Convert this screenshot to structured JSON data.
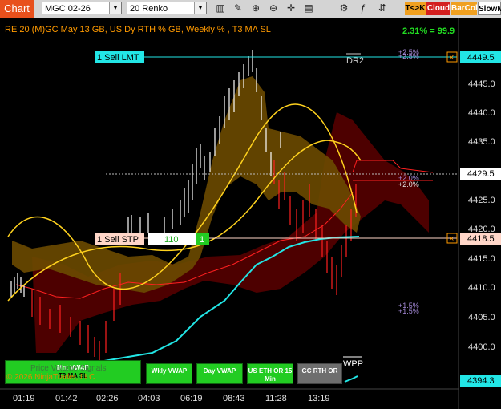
{
  "toolbar": {
    "chart_tab": "Chart",
    "instrument": "MGC 02-26",
    "bar_type": "20 Renko",
    "tk_label": "T<>K",
    "cloud_label": "Cloud",
    "barcol_label": "BarCol",
    "slowm_label": "SlowM",
    "icons": [
      "bar-style-icon",
      "drawing-tool-icon",
      "zoom-in-icon",
      "zoom-out-icon",
      "crosshair-icon",
      "properties-icon",
      "strategy-icon",
      "indicator-icon",
      "chart-trader-icon"
    ]
  },
  "chart": {
    "header": "RE 20  (M)GC May 13 GB, US Dy RTH % GB, Weekly % , T3 MA SL",
    "pct_readout": "2.31% = 99.9",
    "copyright": "© 2026 NinjaTrader, LLC",
    "watermark": "Price Volume Signals",
    "dr2_label": "DR2",
    "wpp_label": "WPP",
    "pct_plus25": "+2.5%",
    "pct_plus20": "+2.0%",
    "pct_plus15": "+1.5%",
    "sell_lmt": "1 Sell LMT",
    "sell_stp": "1 Sell STP",
    "stp_qty": "110",
    "stp_count": "1",
    "price_axis": [
      "4445.0",
      "4440.0",
      "4435.0",
      "4425.0",
      "4420.0",
      "4415.0",
      "4410.0",
      "4405.0",
      "4400.0"
    ],
    "price_tag_lmt": "4449.5",
    "price_tag_last": "4429.5",
    "price_tag_stp": "4418.5",
    "price_tag_bottom": "4394.3",
    "time_axis": [
      "01:19",
      "01:42",
      "02:26",
      "04:03",
      "06:19",
      "08:43",
      "11:28",
      "13:19"
    ],
    "close_icon": "×",
    "buttons": [
      {
        "label": "Mnt VWAP",
        "sub": "T3 MA SL"
      },
      {
        "label": "Wkly VWAP",
        "sub": ""
      },
      {
        "label": "Day VWAP",
        "sub": ""
      },
      {
        "label": "US ETH OR 15 Min",
        "sub": ""
      },
      {
        "label": "GC RTH OR",
        "sub": ""
      }
    ]
  },
  "colors": {
    "toolbar_bg": "#d4d4d4",
    "chart_bg": "#000000",
    "tab_orange": "#e8501c",
    "cyan": "#22e6e6",
    "red": "#ff2020",
    "gold": "#ffd21e",
    "green_btn": "#22cc22",
    "gray_btn": "#6e6e6e",
    "order_orange": "#ff9a00",
    "header_orange": "#ff9a00"
  }
}
